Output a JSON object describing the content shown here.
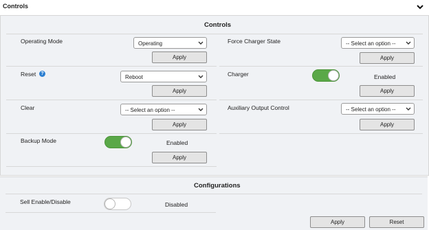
{
  "header": {
    "title": "Controls"
  },
  "controls": {
    "title": "Controls",
    "operating_mode": {
      "label": "Operating Mode",
      "value": "Operating",
      "apply": "Apply"
    },
    "reset": {
      "label": "Reset",
      "help": "?",
      "value": "Reboot",
      "apply": "Apply"
    },
    "clear": {
      "label": "Clear",
      "value": "-- Select an option --",
      "apply": "Apply"
    },
    "backup_mode": {
      "label": "Backup Mode",
      "state": "on",
      "status": "Enabled",
      "apply": "Apply"
    },
    "force_charger_state": {
      "label": "Force Charger State",
      "value": "-- Select an option --",
      "apply": "Apply"
    },
    "charger": {
      "label": "Charger",
      "state": "on",
      "status": "Enabled",
      "apply": "Apply"
    },
    "auxiliary_output": {
      "label": "Auxiliary Output Control",
      "value": "-- Select an option --",
      "apply": "Apply"
    }
  },
  "configurations": {
    "title": "Configurations",
    "sell_enable": {
      "label": "Sell Enable/Disable",
      "state": "off",
      "status": "Disabled"
    },
    "apply": "Apply",
    "reset": "Reset"
  },
  "colors": {
    "toggle_on": "#5aa848",
    "panel_bg": "#f0f2f5",
    "help_icon": "#2c7fd1"
  }
}
